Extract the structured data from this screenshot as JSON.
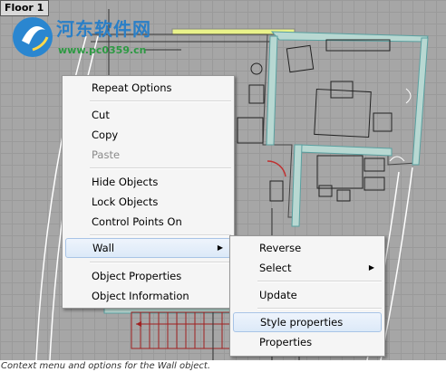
{
  "window": {
    "floor_tab": "Floor 1"
  },
  "watermark": {
    "text": "河东软件网",
    "url": "www.pc0359.cn"
  },
  "context_menu": {
    "items": [
      {
        "label": "Repeat Options"
      },
      {
        "label": "Cut"
      },
      {
        "label": "Copy"
      },
      {
        "label": "Paste",
        "disabled": true
      },
      {
        "label": "Hide Objects"
      },
      {
        "label": "Lock Objects"
      },
      {
        "label": "Control Points On"
      },
      {
        "label": "Wall",
        "submenu": true,
        "highlighted": true
      },
      {
        "label": "Object Properties"
      },
      {
        "label": "Object Information"
      }
    ]
  },
  "wall_submenu": {
    "items": [
      {
        "label": "Reverse"
      },
      {
        "label": "Select",
        "submenu": true
      },
      {
        "label": "Update"
      },
      {
        "label": "Style properties",
        "highlighted": true
      },
      {
        "label": "Properties"
      }
    ]
  },
  "caption": "Context menu and options for the Wall object.",
  "colors": {
    "wall_fill": "#b8d8d2",
    "wall_line": "#5aa0a0",
    "highlight": "#dce9f8",
    "stairs": "#a02020"
  }
}
